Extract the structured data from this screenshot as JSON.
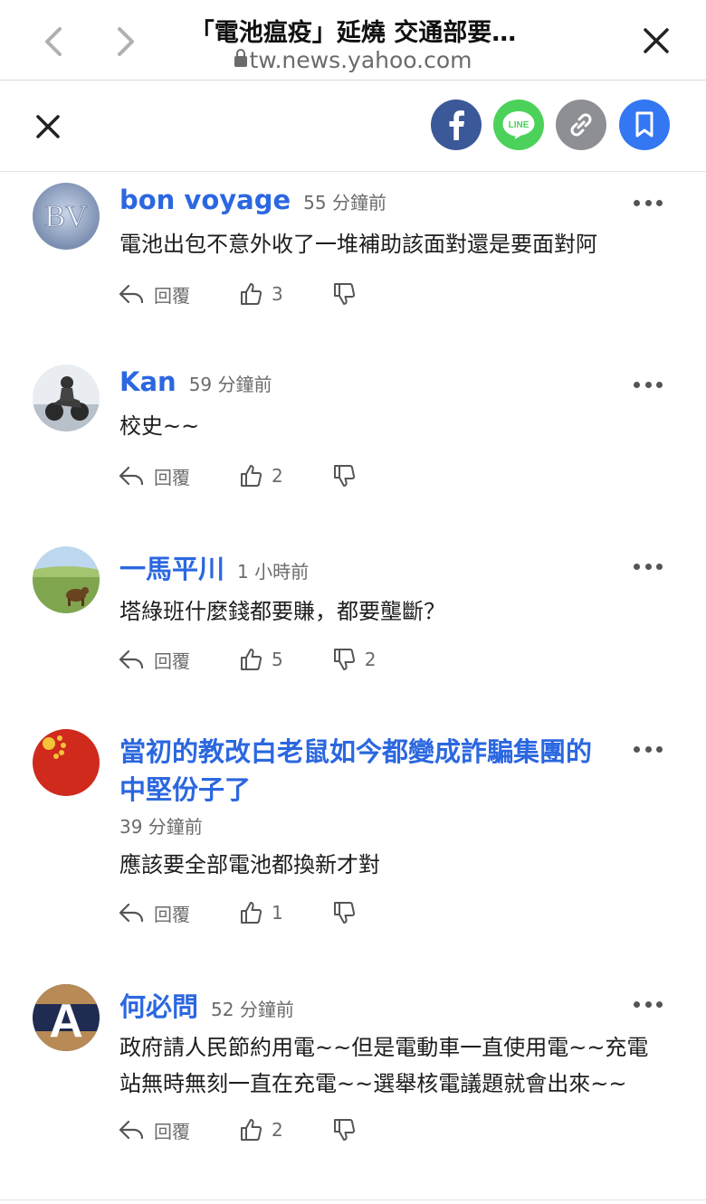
{
  "browser": {
    "title": "「電池瘟疫」延燒 交通部要…",
    "url": "tw.news.yahoo.com"
  },
  "share": {
    "facebook": "facebook",
    "line_label": "LINE",
    "copy_link": "link",
    "bookmark": "bookmark"
  },
  "comments": [
    {
      "author": "bon voyage",
      "time": "55 分鐘前",
      "text": "電池出包不意外收了一堆補助該面對還是要面對阿",
      "reply_label": "回覆",
      "likes": "3",
      "dislikes": "",
      "avatar_text": "BV"
    },
    {
      "author": "Kan",
      "time": "59 分鐘前",
      "text": "校史~~",
      "reply_label": "回覆",
      "likes": "2",
      "dislikes": ""
    },
    {
      "author": "一馬平川",
      "time": "1 小時前",
      "text": "塔綠班什麼錢都要賺，都要壟斷？",
      "reply_label": "回覆",
      "likes": "5",
      "dislikes": "2"
    },
    {
      "author_line1": "當初的教改白老鼠如今都變成詐騙集團的",
      "author_line2": "中堅份子了",
      "time": "39 分鐘前",
      "text": "應該要全部電池都換新才對",
      "reply_label": "回覆",
      "likes": "1",
      "dislikes": ""
    },
    {
      "author": "何必問",
      "time": "52 分鐘前",
      "text_line1": "政府請人民節約用電~~但是電動車一直使用電~~充電",
      "text_line2": "站無時無刻一直在充電~~選舉核電議題就會出來~~",
      "reply_label": "回覆",
      "likes": "2",
      "dislikes": "",
      "avatar_text": "A"
    }
  ],
  "colors": {
    "author": "#2b67e0",
    "facebook": "#3b5998",
    "line": "#4cd25a",
    "link": "#8e8f94",
    "bookmark": "#3477f2"
  }
}
